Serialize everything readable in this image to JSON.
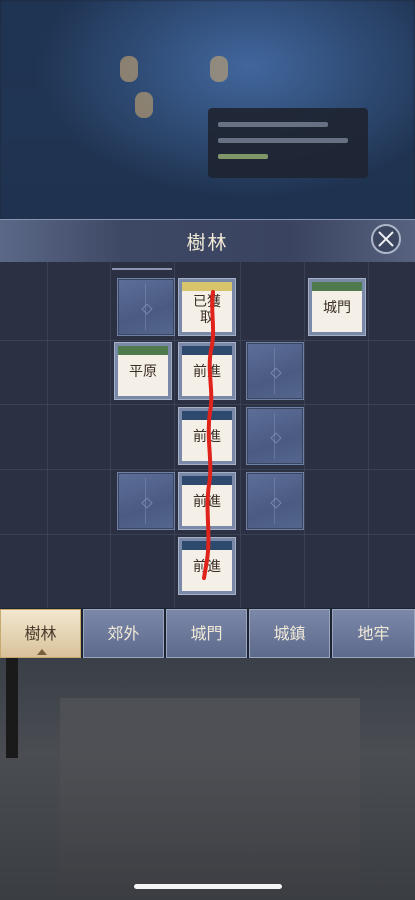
{
  "panel": {
    "title": "樹林"
  },
  "tiles": {
    "r0c2": {
      "text": "",
      "state": "hidden"
    },
    "r0c3": {
      "text": "已獲取",
      "line1": "已獲",
      "line2": "取",
      "state": "collected"
    },
    "r0c5": {
      "text": "城門",
      "state": "exit"
    },
    "r1c2": {
      "text": "平原",
      "state": "exit"
    },
    "r1c3": {
      "text": "前進",
      "state": "path"
    },
    "r1c4": {
      "text": "",
      "state": "hidden"
    },
    "r2c3": {
      "text": "前進",
      "state": "path"
    },
    "r2c4": {
      "text": "",
      "state": "hidden"
    },
    "r3c2": {
      "text": "",
      "state": "hidden"
    },
    "r3c3": {
      "text": "前進",
      "state": "path"
    },
    "r3c4": {
      "text": "",
      "state": "hidden"
    },
    "r4c3": {
      "text": "前進",
      "state": "path"
    }
  },
  "tabs": [
    {
      "label": "樹林",
      "active": true
    },
    {
      "label": "郊外",
      "active": false
    },
    {
      "label": "城門",
      "active": false
    },
    {
      "label": "城鎮",
      "active": false
    },
    {
      "label": "地牢",
      "active": false
    }
  ],
  "colors": {
    "route": "#e0241b",
    "band_blue": "#2d4a6e",
    "band_green": "#4f7a4e",
    "band_yellow": "#d8c46a"
  }
}
